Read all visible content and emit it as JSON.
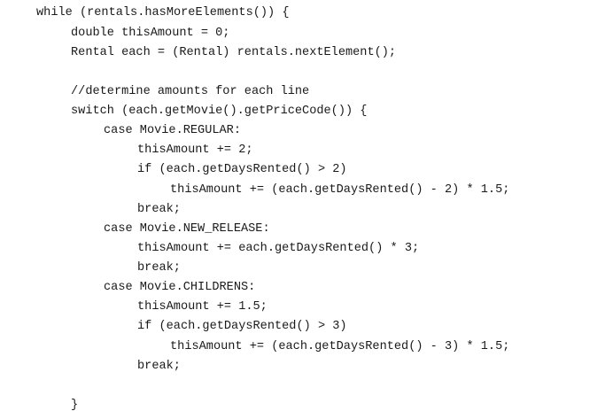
{
  "code": {
    "lines": [
      "while (rentals.hasMoreElements()) {",
      "double thisAmount = 0;",
      "Rental each = (Rental) rentals.nextElement();",
      "",
      "//determine amounts for each line",
      "switch (each.getMovie().getPriceCode()) {",
      "case Movie.REGULAR:",
      "thisAmount += 2;",
      "if (each.getDaysRented() > 2)",
      "thisAmount += (each.getDaysRented() - 2) * 1.5;",
      "break;",
      "case Movie.NEW_RELEASE:",
      "thisAmount += each.getDaysRented() * 3;",
      "break;",
      "case Movie.CHILDRENS:",
      "thisAmount += 1.5;",
      "if (each.getDaysRented() > 3)",
      "thisAmount += (each.getDaysRented() - 3) * 1.5;",
      "break;",
      "",
      "}"
    ]
  }
}
